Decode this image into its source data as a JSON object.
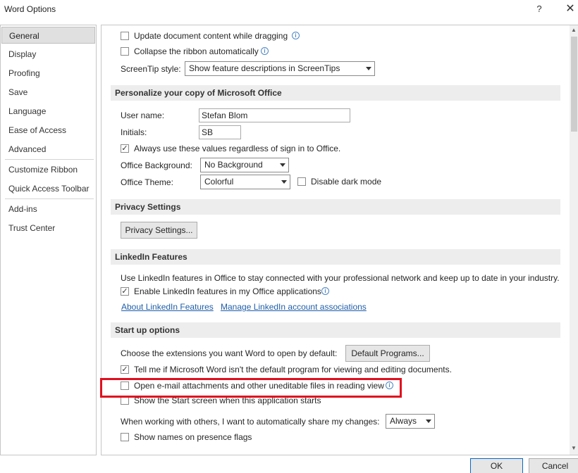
{
  "window": {
    "title": "Word Options",
    "help_label": "?",
    "close_label": "✕"
  },
  "sidebar": {
    "items": [
      {
        "label": "General",
        "selected": true
      },
      {
        "label": "Display"
      },
      {
        "label": "Proofing"
      },
      {
        "label": "Save"
      },
      {
        "label": "Language"
      },
      {
        "label": "Ease of Access"
      },
      {
        "label": "Advanced"
      },
      {
        "label": "Customize Ribbon"
      },
      {
        "label": "Quick Access Toolbar"
      },
      {
        "label": "Add-ins"
      },
      {
        "label": "Trust Center"
      }
    ]
  },
  "ui_options": {
    "update_dragging": {
      "label": "Update document content while dragging",
      "checked": false
    },
    "collapse_ribbon": {
      "label": "Collapse the ribbon automatically",
      "checked": false
    },
    "screentip_label": "ScreenTip style:",
    "screentip_value": "Show feature descriptions in ScreenTips"
  },
  "personalize": {
    "header": "Personalize your copy of Microsoft Office",
    "username_label": "User name:",
    "username_value": "Stefan Blom",
    "initials_label": "Initials:",
    "initials_value": "SB",
    "always_use": {
      "label": "Always use these values regardless of sign in to Office.",
      "checked": true
    },
    "background_label": "Office Background:",
    "background_value": "No Background",
    "theme_label": "Office Theme:",
    "theme_value": "Colorful",
    "dark_mode": {
      "label": "Disable dark mode",
      "checked": false
    }
  },
  "privacy": {
    "header": "Privacy Settings",
    "button_label": "Privacy Settings..."
  },
  "linkedin": {
    "header": "LinkedIn Features",
    "description": "Use LinkedIn features in Office to stay connected with your professional network and keep up to date in your industry.",
    "enable": {
      "label": "Enable LinkedIn features in my Office applications",
      "checked": true
    },
    "about_link": "About LinkedIn Features",
    "manage_link": "Manage LinkedIn account associations"
  },
  "startup": {
    "header": "Start up options",
    "extensions_label": "Choose the extensions you want Word to open by default:",
    "default_programs_button": "Default Programs...",
    "tell_me": {
      "label": "Tell me if Microsoft Word isn't the default program for viewing and editing documents.",
      "checked": true
    },
    "open_attachments": {
      "label": "Open e-mail attachments and other uneditable files in reading view",
      "checked": false
    },
    "show_start": {
      "label": "Show the Start screen when this application starts",
      "checked": false
    }
  },
  "coauthoring": {
    "share_label": "When working with others, I want to automatically share my changes:",
    "share_value": "Always",
    "presence": {
      "label": "Show names on presence flags",
      "checked": false
    }
  },
  "footer": {
    "ok_label": "OK",
    "cancel_label": "Cancel"
  },
  "colors": {
    "highlight": "#e0101e",
    "link": "#1f5ea8",
    "section_bg": "#ededed",
    "selected_nav": "#e0e0e0"
  }
}
